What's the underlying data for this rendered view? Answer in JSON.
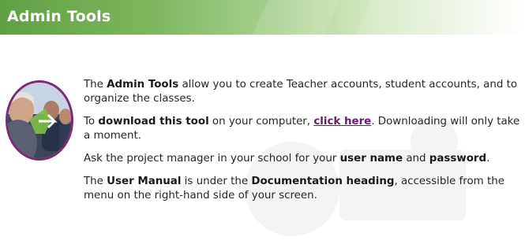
{
  "header": {
    "title": "Admin Tools",
    "background_color": "#6aab4c"
  },
  "avatar": {
    "icon": "group-photo-avatar-icon",
    "ring_color": "#7a2b72"
  },
  "content": {
    "p1": {
      "t1": "The ",
      "b1": "Admin Tools",
      "t2": " allow you to create Teacher accounts, student accounts, and to organize the classes."
    },
    "p2": {
      "t1": "To ",
      "b1": "download this tool",
      "t2": " on your computer, ",
      "link": "click here",
      "t3": ". Downloading will only take a moment."
    },
    "p3": {
      "t1": "Ask the project manager in your school for your ",
      "b1": "user name",
      "t2": " and ",
      "b2": "password",
      "t3": "."
    },
    "p4": {
      "t1": "The ",
      "b1": "User Manual",
      "t2": " is under the ",
      "b2": "Documentation heading",
      "t3": ", accessible from the menu on the right-hand side of your screen."
    },
    "link_color": "#6b1770"
  }
}
